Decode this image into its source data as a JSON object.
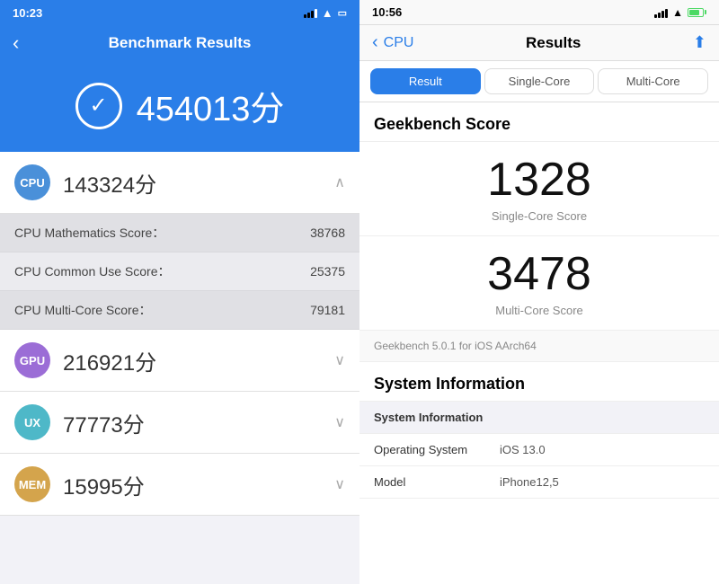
{
  "left": {
    "status": {
      "time": "10:23"
    },
    "header": {
      "back": "‹",
      "title": "Benchmark Results"
    },
    "total_score": "454013分",
    "categories": [
      {
        "id": "cpu",
        "label": "CPU",
        "score": "143324分",
        "color": "cpu-icon",
        "expanded": true,
        "details": [
          {
            "label": "CPU Mathematics Score：",
            "value": "38768"
          },
          {
            "label": "CPU Common Use Score：",
            "value": "25375"
          },
          {
            "label": "CPU Multi-Core Score：",
            "value": "79181"
          }
        ]
      },
      {
        "id": "gpu",
        "label": "GPU",
        "score": "216921分",
        "color": "gpu-icon",
        "expanded": false
      },
      {
        "id": "ux",
        "label": "UX",
        "score": "77773分",
        "color": "ux-icon",
        "expanded": false
      },
      {
        "id": "mem",
        "label": "MEM",
        "score": "15995分",
        "color": "mem-icon",
        "expanded": false
      }
    ]
  },
  "right": {
    "status": {
      "time": "10:56"
    },
    "header": {
      "back_label": "CPU",
      "title": "Results"
    },
    "tabs": [
      {
        "id": "result",
        "label": "Result",
        "active": true
      },
      {
        "id": "single-core",
        "label": "Single-Core",
        "active": false
      },
      {
        "id": "multi-core",
        "label": "Multi-Core",
        "active": false
      }
    ],
    "geekbench_title": "Geekbench Score",
    "single_core_score": "1328",
    "single_core_label": "Single-Core Score",
    "multi_core_score": "3478",
    "multi_core_label": "Multi-Core Score",
    "version_text": "Geekbench 5.0.1 for iOS AArch64",
    "sys_info_title": "System Information",
    "sys_info_rows": [
      {
        "header": true,
        "label": "System Information",
        "value": ""
      },
      {
        "header": false,
        "label": "Operating System",
        "value": "iOS 13.0"
      },
      {
        "header": false,
        "label": "Model",
        "value": "iPhone12,5"
      }
    ]
  }
}
